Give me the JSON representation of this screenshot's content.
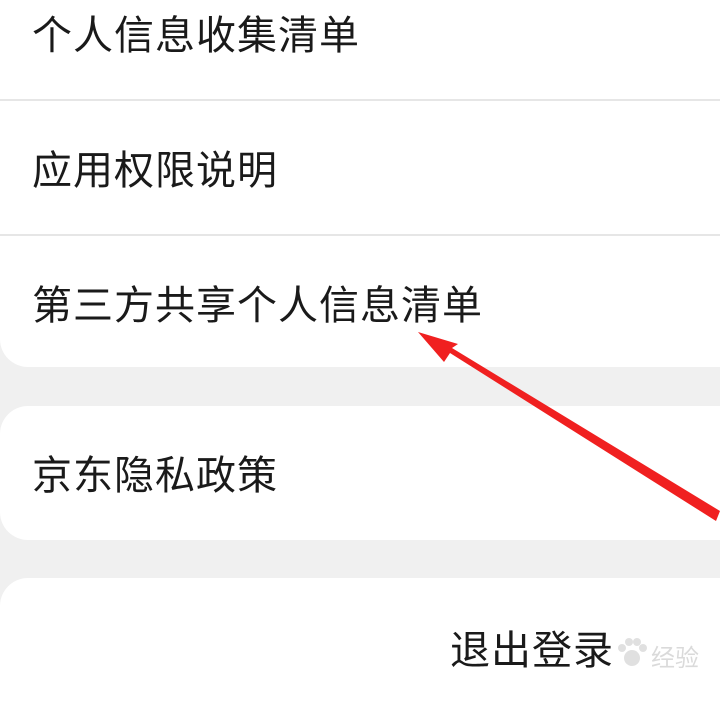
{
  "menu": {
    "items": [
      {
        "label": "个人信息收集清单"
      },
      {
        "label": "应用权限说明"
      },
      {
        "label": "第三方共享个人信息清单"
      },
      {
        "label": "京东隐私政策"
      }
    ]
  },
  "logout": {
    "label": "退出登录"
  },
  "watermark": {
    "text": "经验"
  },
  "colors": {
    "background": "#f0f0f0",
    "card": "#ffffff",
    "annotation_arrow": "#f02020"
  },
  "annotation": {
    "icon": "red-arrow-pointer",
    "target": "第三方共享个人信息清单"
  }
}
